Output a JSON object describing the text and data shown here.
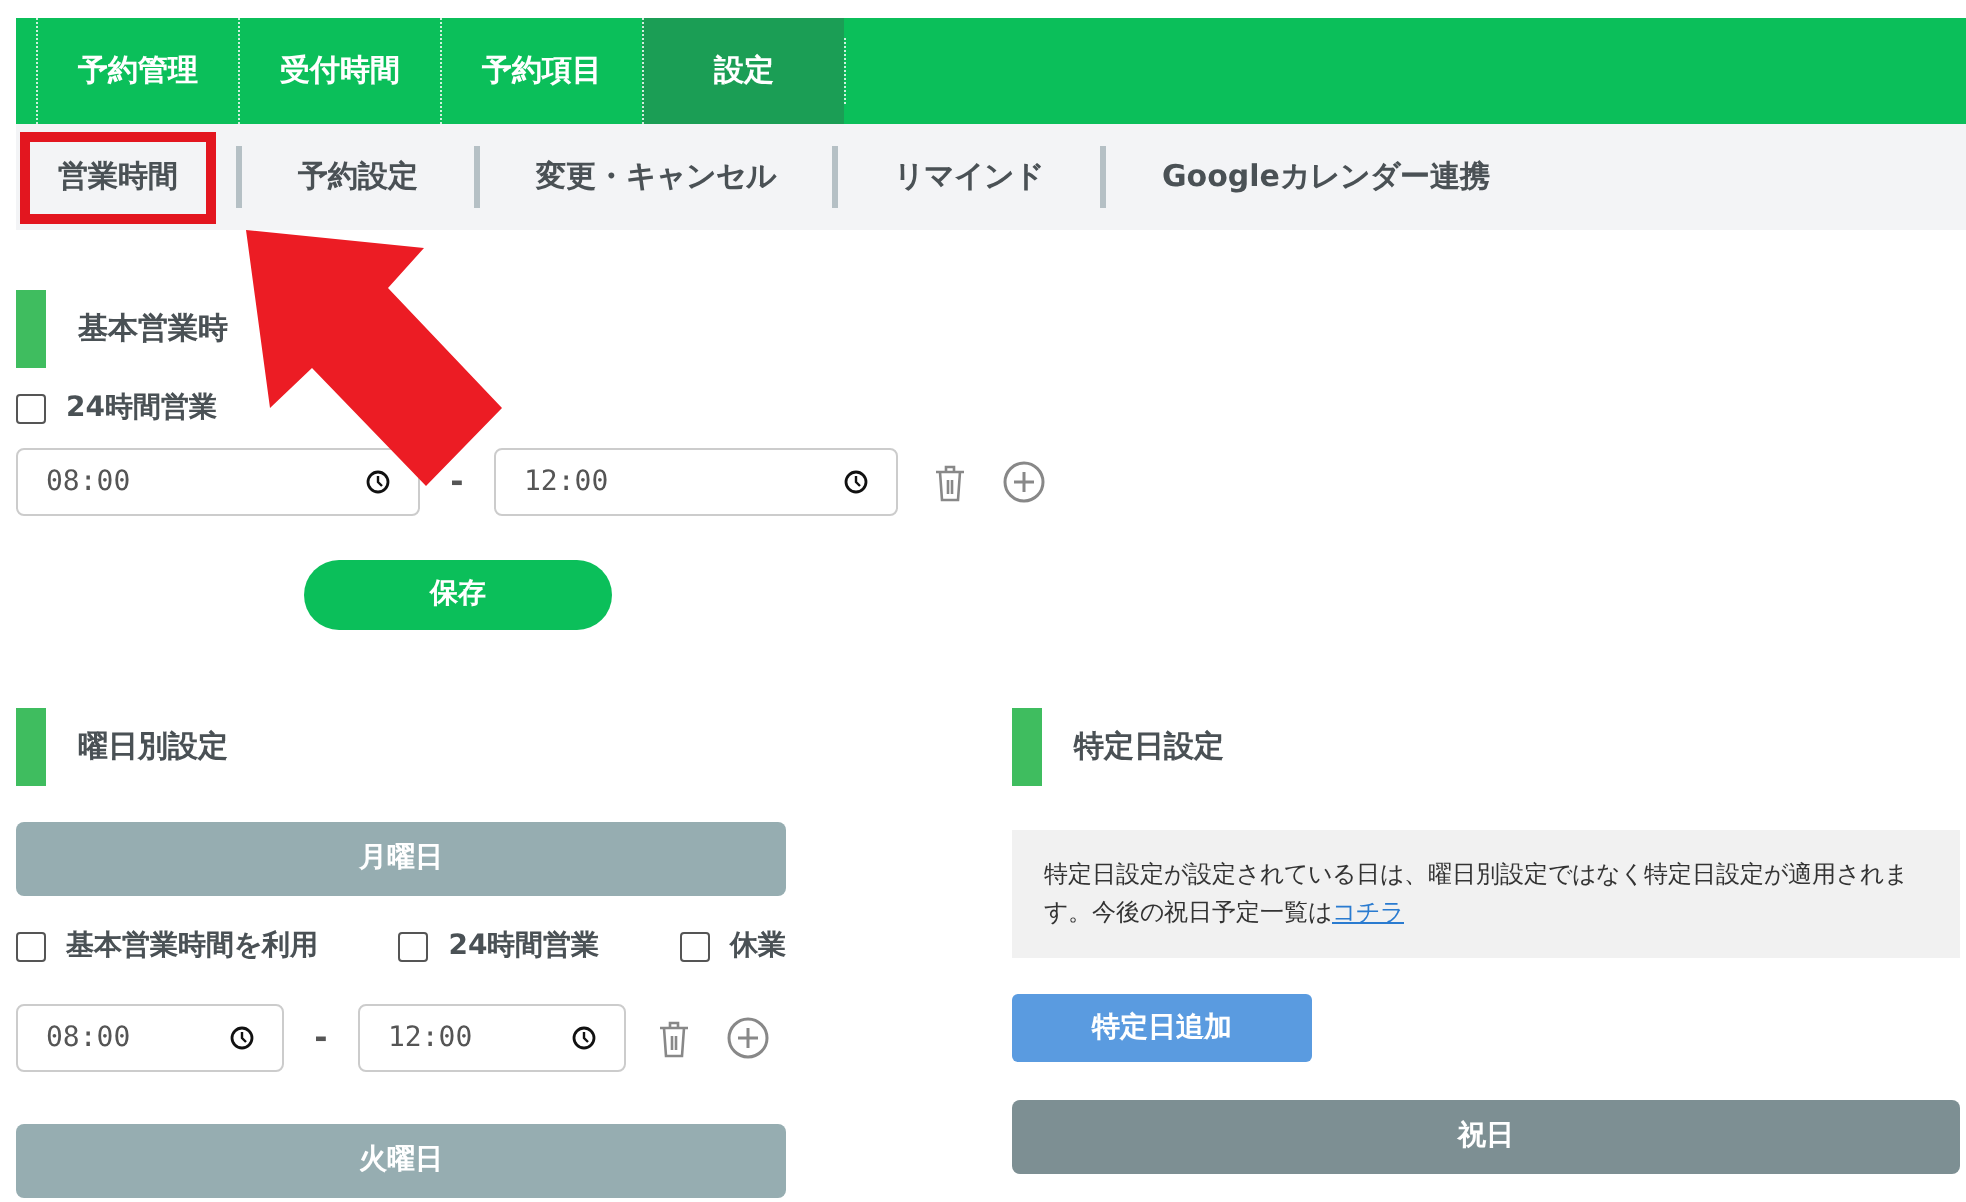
{
  "main_nav": [
    {
      "label": "予約管理",
      "selected": false
    },
    {
      "label": "受付時間",
      "selected": false
    },
    {
      "label": "予約項目",
      "selected": false
    },
    {
      "label": "設定",
      "selected": true
    }
  ],
  "sub_nav": [
    {
      "label": "営業時間",
      "selected": true
    },
    {
      "label": "予約設定",
      "selected": false
    },
    {
      "label": "変更・キャンセル",
      "selected": false
    },
    {
      "label": "リマインド",
      "selected": false
    },
    {
      "label": "Googleカレンダー連携",
      "selected": false
    }
  ],
  "basic_hours": {
    "title": "基本営業時",
    "options": [
      {
        "label": "24時間営業",
        "checked": false
      }
    ],
    "start": "08:00",
    "separator": "-",
    "end": "12:00",
    "save_button": "保存"
  },
  "weekday_settings": {
    "title": "曜日別設定",
    "days": [
      {
        "label": "月曜日",
        "options": [
          {
            "label": "基本営業時間を利用",
            "checked": false
          },
          {
            "label": "24時間営業",
            "checked": false
          },
          {
            "label": "休業",
            "checked": false
          }
        ],
        "start": "08:00",
        "separator": "-",
        "end": "12:00"
      },
      {
        "label": "火曜日"
      }
    ]
  },
  "special_days": {
    "title": "特定日設定",
    "note": "特定日設定が設定されている日は、曜日別設定ではなく特定日設定が適用されます。今後の祝日予定一覧は",
    "note_link": "コチラ",
    "add_button": "特定日追加",
    "holiday_bar": "祝日"
  }
}
